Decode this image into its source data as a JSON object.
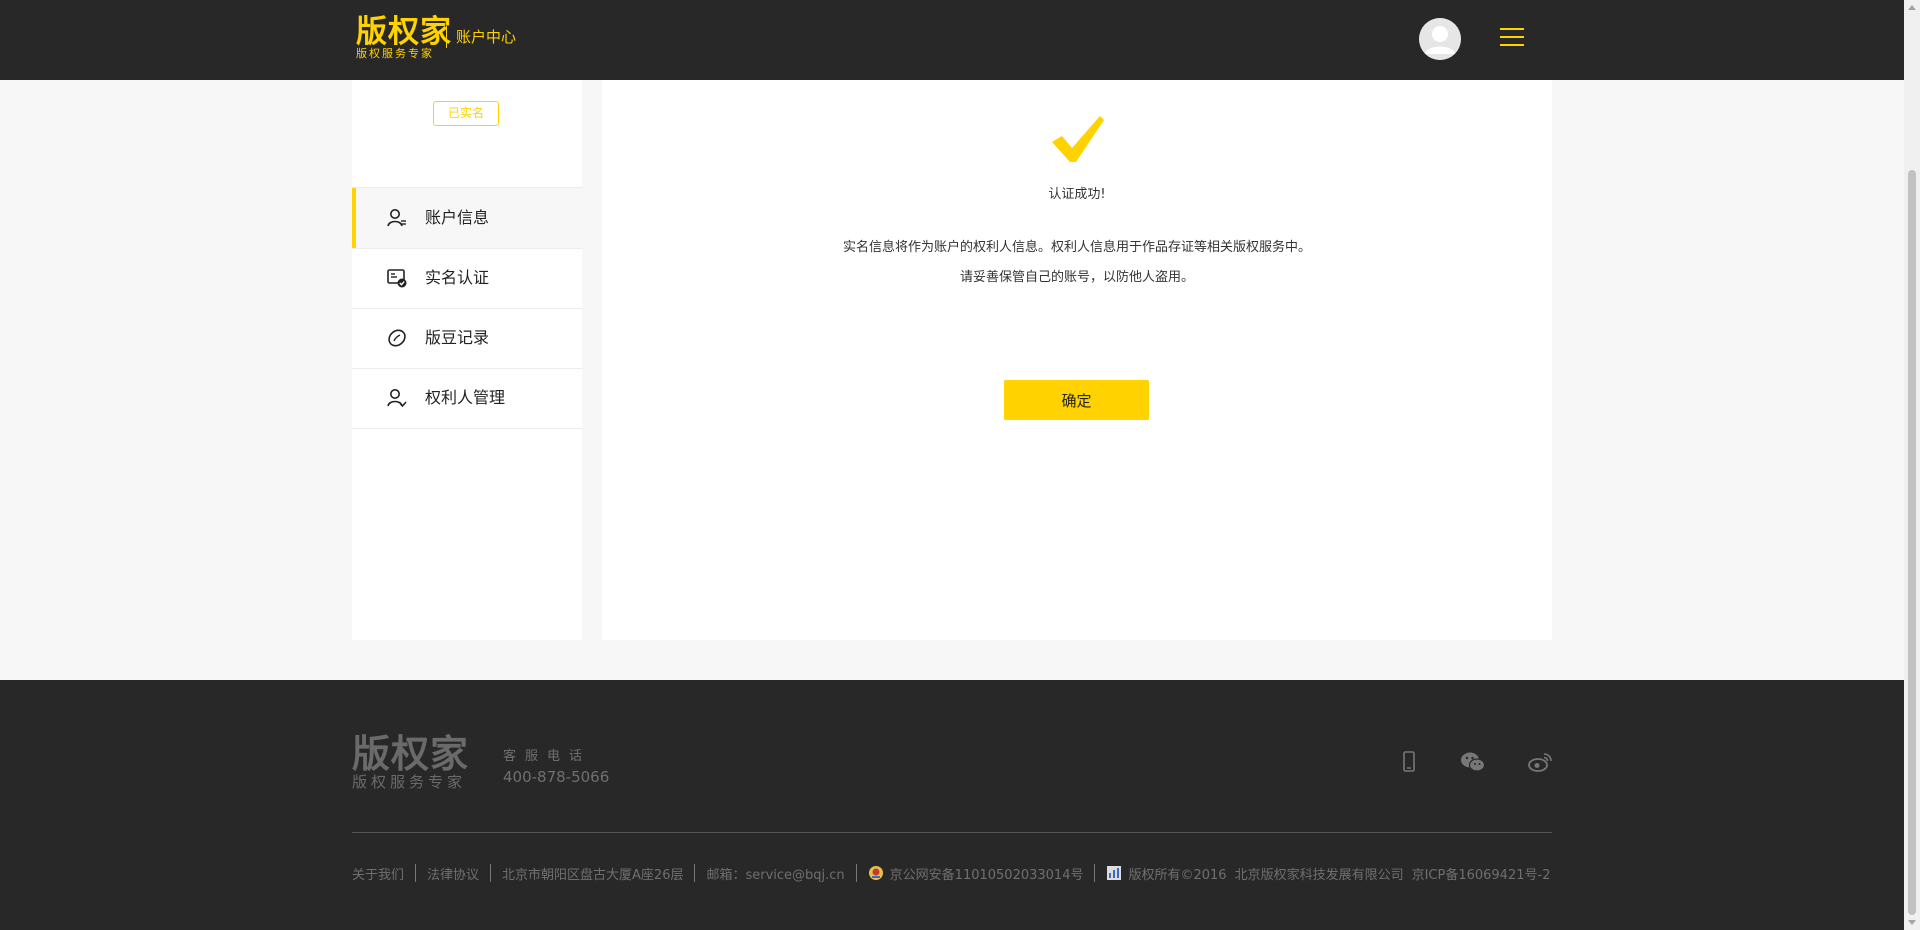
{
  "header": {
    "logo_main": "版权家",
    "logo_sub": "版权服务专家",
    "section_label": "账户中心",
    "avatar_icon": "user-avatar-icon",
    "menu_icon": "hamburger-menu-icon",
    "accent_color": "#ffd200"
  },
  "sidebar": {
    "badge": "已实名",
    "items": [
      {
        "label": "账户信息",
        "icon": "user-info-icon",
        "active": true
      },
      {
        "label": "实名认证",
        "icon": "id-card-check-icon",
        "active": false
      },
      {
        "label": "版豆记录",
        "icon": "bean-icon",
        "active": false
      },
      {
        "label": "权利人管理",
        "icon": "user-check-icon",
        "active": false
      }
    ]
  },
  "main": {
    "check_icon": "checkmark-icon",
    "title": "认证成功!",
    "lines": [
      "实名信息将作为账户的权利人信息。权利人信息用于作品存证等相关版权服务中。",
      "请妥善保管自己的账号，以防他人盗用。"
    ],
    "confirm_button": "确定"
  },
  "footer": {
    "logo_main": "版权家",
    "logo_sub": "版权服务专家",
    "phone_label": "客服电话",
    "phone": "400-878-5066",
    "social_icons": [
      "mobile-phone-icon",
      "wechat-icon",
      "weibo-icon"
    ],
    "links": {
      "about": "关于我们",
      "legal": "法律协议",
      "address": "北京市朝阳区盘古大厦A座26层",
      "email": "邮箱：service@bqj.cn",
      "police": "京公网安备11010502033014号",
      "copyright": "版权所有©2016",
      "company": "北京版权家科技发展有限公司",
      "icp": "京ICP备16069421号-2"
    }
  }
}
